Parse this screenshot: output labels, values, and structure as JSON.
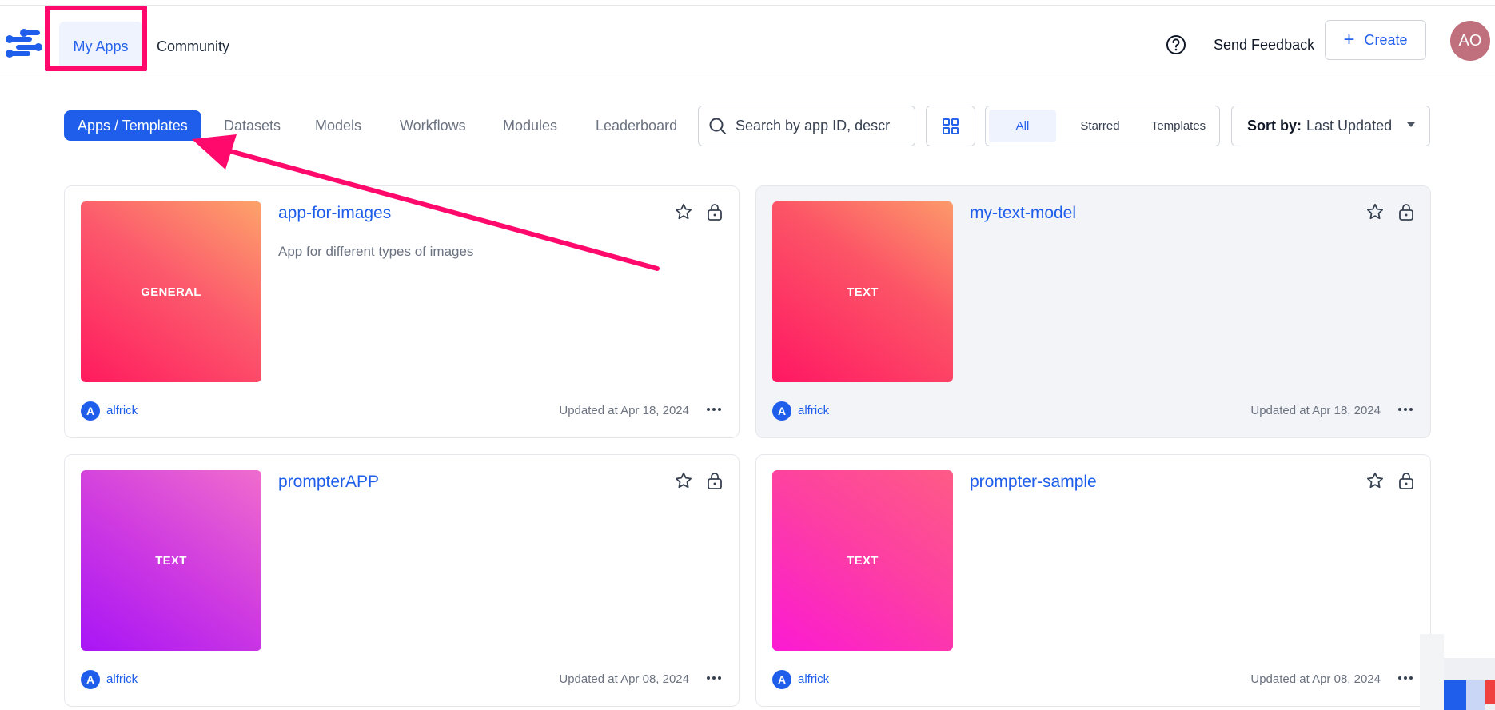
{
  "header": {
    "nav": {
      "my_apps": "My Apps",
      "community": "Community"
    },
    "send_feedback": "Send Feedback",
    "create_label": "Create",
    "create_icon": "+",
    "avatar_initials": "AO"
  },
  "toolbar": {
    "tabs": [
      "Apps / Templates",
      "Datasets",
      "Models",
      "Workflows",
      "Modules",
      "Leaderboard"
    ],
    "active_tab": "Apps / Templates",
    "search_placeholder": "Search by app ID, descr",
    "filters": [
      "All",
      "Starred",
      "Templates"
    ],
    "active_filter": "All",
    "sort_prefix": "Sort by:",
    "sort_value": "Last Updated"
  },
  "cards": [
    {
      "title": "app-for-images",
      "description": "App for different types of images",
      "thumb_label": "GENERAL",
      "owner_initial": "A",
      "owner": "alfrick",
      "updated": "Updated at Apr 18, 2024"
    },
    {
      "title": "my-text-model",
      "description": "",
      "thumb_label": "TEXT",
      "owner_initial": "A",
      "owner": "alfrick",
      "updated": "Updated at Apr 18, 2024"
    },
    {
      "title": "prompterAPP",
      "description": "",
      "thumb_label": "TEXT",
      "owner_initial": "A",
      "owner": "alfrick",
      "updated": "Updated at Apr 08, 2024"
    },
    {
      "title": "prompter-sample",
      "description": "",
      "thumb_label": "TEXT",
      "owner_initial": "A",
      "owner": "alfrick",
      "updated": "Updated at Apr 08, 2024"
    }
  ],
  "colors": {
    "accent": "#1e5eea",
    "annotation": "#ff0a6c",
    "avatar": "#c0707c"
  }
}
